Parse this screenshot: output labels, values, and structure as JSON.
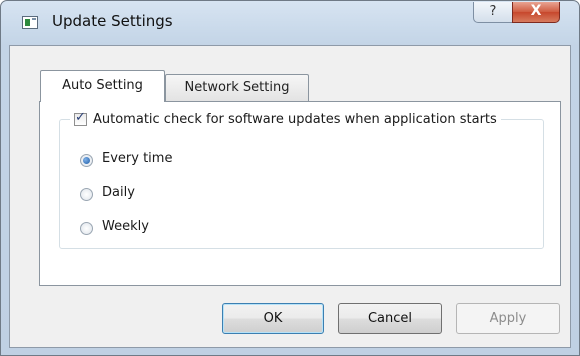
{
  "window": {
    "title": "Update Settings",
    "help_label": "?",
    "close_label": "X"
  },
  "tabs": [
    {
      "label": "Auto Setting",
      "selected": true
    },
    {
      "label": "Network Setting",
      "selected": false
    }
  ],
  "auto_setting": {
    "check_label": "Automatic check for software updates when application starts",
    "check_checked": true,
    "options": [
      {
        "label": "Every time",
        "selected": true
      },
      {
        "label": "Daily",
        "selected": false
      },
      {
        "label": "Weekly",
        "selected": false
      }
    ]
  },
  "buttons": {
    "ok": "OK",
    "cancel": "Cancel",
    "apply": "Apply",
    "apply_enabled": false
  },
  "colors": {
    "frame": "#c9d9ea",
    "close_button": "#c7472c",
    "radio_selected": "#1f5da8"
  }
}
